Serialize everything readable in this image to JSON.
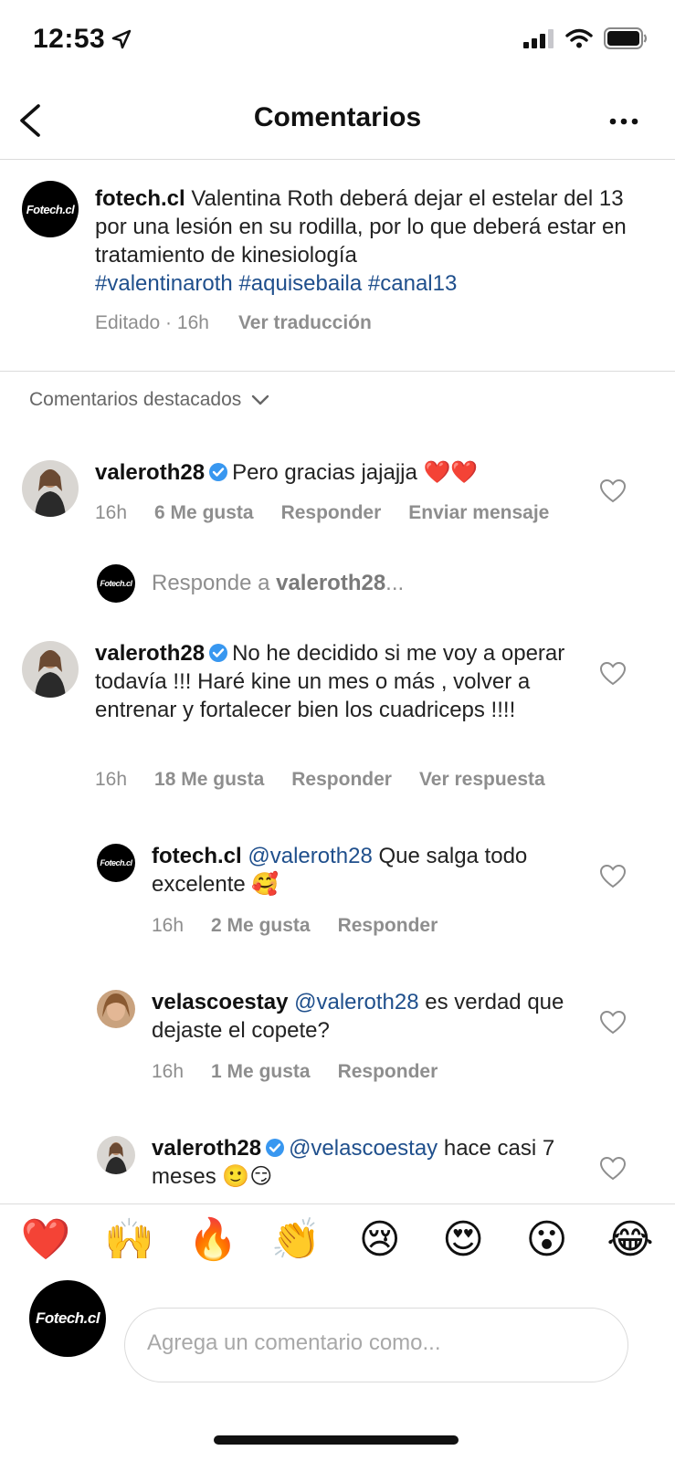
{
  "status_bar": {
    "time": "12:53"
  },
  "header": {
    "title": "Comentarios"
  },
  "caption": {
    "avatar_text": "Fotech.cl",
    "username": "fotech.cl",
    "text": "Valentina Roth deberá dejar el estelar del 13 por una lesión en su rodilla, por lo que deberá estar en tratamiento de kinesiología",
    "hashtags": [
      "#valentinaroth",
      "#aquisebaila",
      "#canal13"
    ],
    "meta": "Editado · 16h",
    "translate": "Ver traducción"
  },
  "section_label": "Comentarios destacados",
  "comments": [
    {
      "username": "valeroth28",
      "text": "Pero gracias jajajja ❤️❤️",
      "time": "16h",
      "likes": "6 Me gusta",
      "reply": "Responder",
      "extra": "Enviar mensaje"
    },
    {
      "username": "valeroth28",
      "text": "No he decidido si me voy a operar todavía !!! Haré kine un mes o más , volver a entrenar y fortalecer bien los cuadriceps !!!!",
      "time": "16h",
      "likes": "18 Me gusta",
      "reply": "Responder",
      "extra": "Ver respuesta"
    }
  ],
  "reply_prompt": {
    "prefix": "Responde a ",
    "username": "valeroth28",
    "suffix": "..."
  },
  "replies": [
    {
      "username": "fotech.cl",
      "mention": "@valeroth28",
      "text": "Que salga todo excelente 🥰",
      "time": "16h",
      "likes": "2 Me gusta",
      "reply": "Responder"
    },
    {
      "username": "velascoestay",
      "mention": "@valeroth28",
      "text": "es verdad que dejaste el copete?",
      "time": "16h",
      "likes": "1 Me gusta",
      "reply": "Responder"
    },
    {
      "username": "valeroth28",
      "mention": "@velascoestay",
      "text": "hace casi 7 meses 🙂😏"
    }
  ],
  "emojis": [
    "❤️",
    "🙌",
    "🔥",
    "👏",
    "😢",
    "😍",
    "😮",
    "😂"
  ],
  "compose": {
    "placeholder": "Agrega un comentario como..."
  },
  "colors": {
    "link": "#1f4f8c",
    "verified": "#3897f0",
    "muted": "#8e8e8e",
    "brand_red": "#e0202a"
  }
}
